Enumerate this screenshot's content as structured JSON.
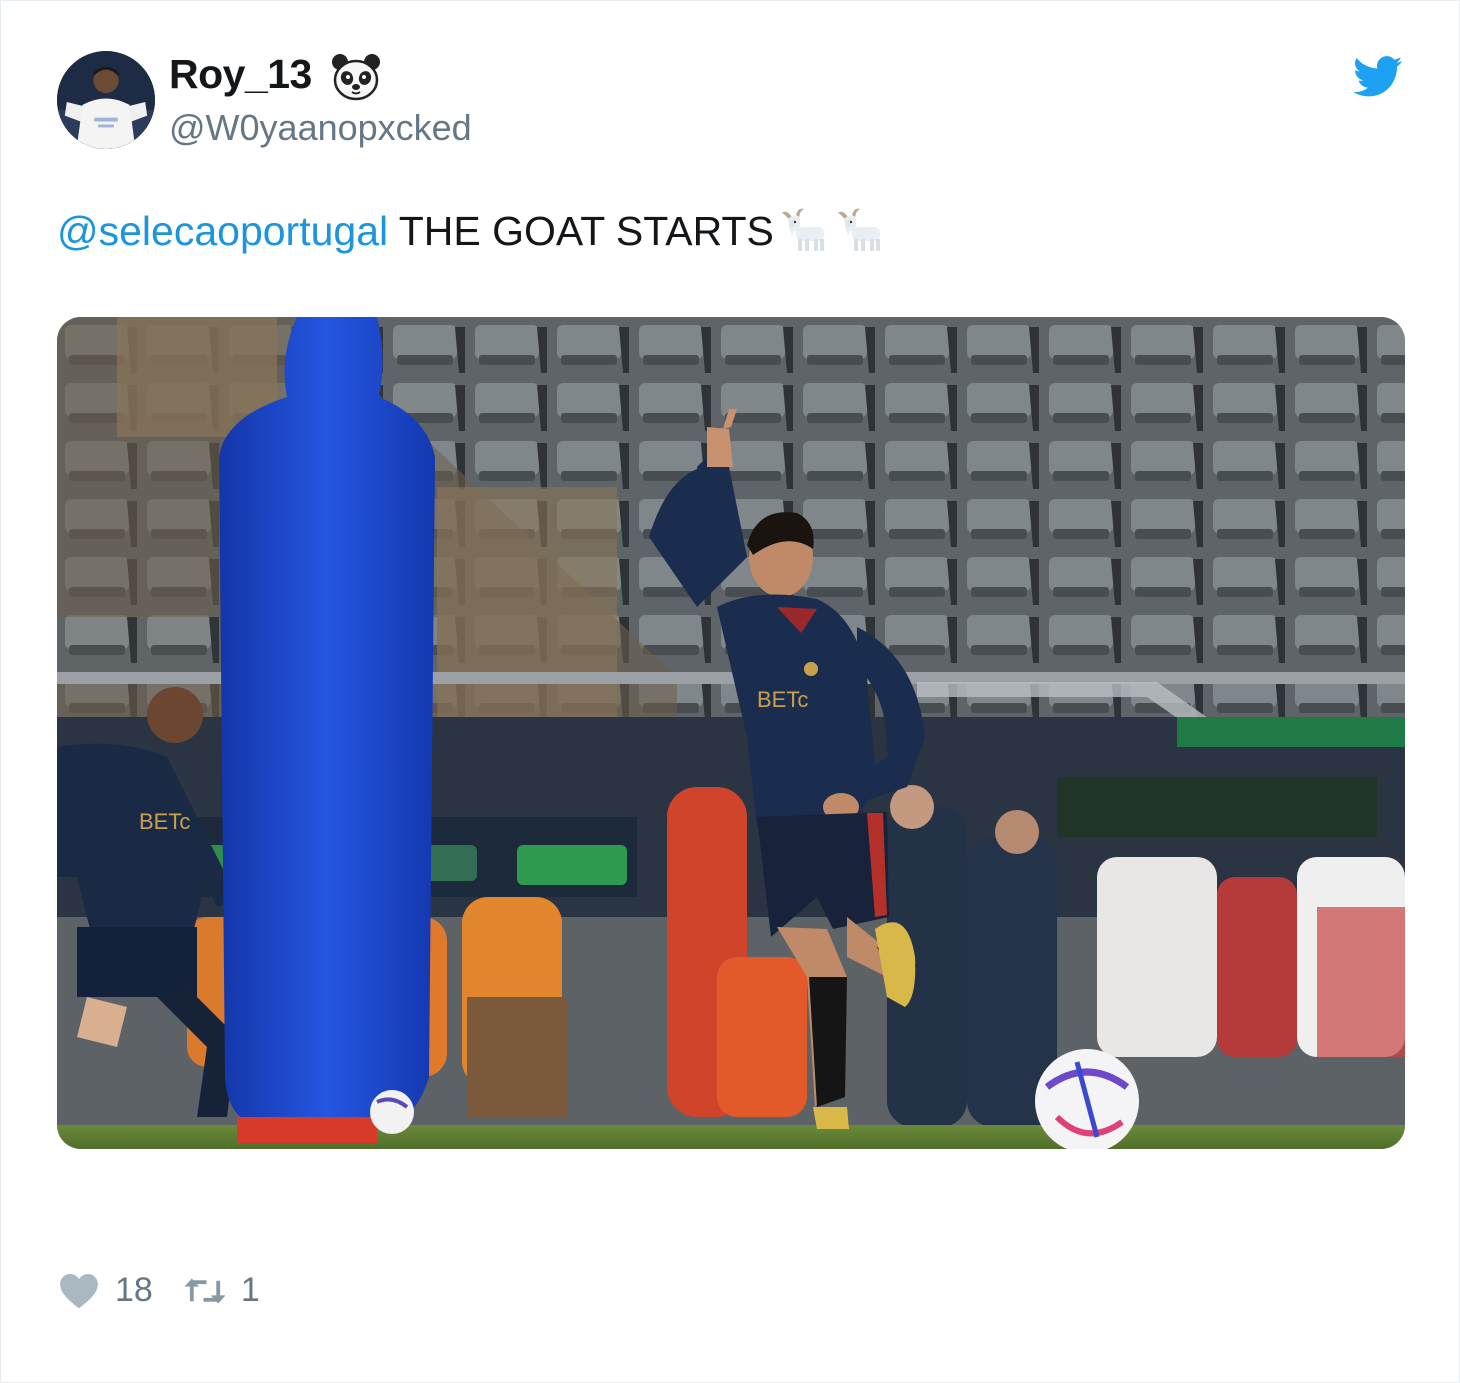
{
  "tweet": {
    "author": {
      "display_name": "Roy_13",
      "display_name_emoji": "panda-face",
      "handle": "@W0yaanopxcked"
    },
    "text": {
      "mention": "@selecaoportugal",
      "body": " THE GOAT STARTS",
      "emojis": [
        "goat",
        "goat"
      ]
    },
    "media": {
      "kind": "photo"
    },
    "stats": {
      "likes": "18",
      "retweets": "1"
    }
  },
  "icons": {
    "brand": "twitter-bird-icon",
    "like": "heart-icon",
    "retweet": "retweet-icon"
  },
  "colors": {
    "brand_blue": "#1da1f2",
    "mention_blue": "#1b95e0",
    "text": "#14171a",
    "muted": "#657786",
    "like_gray": "#aab8c2"
  }
}
